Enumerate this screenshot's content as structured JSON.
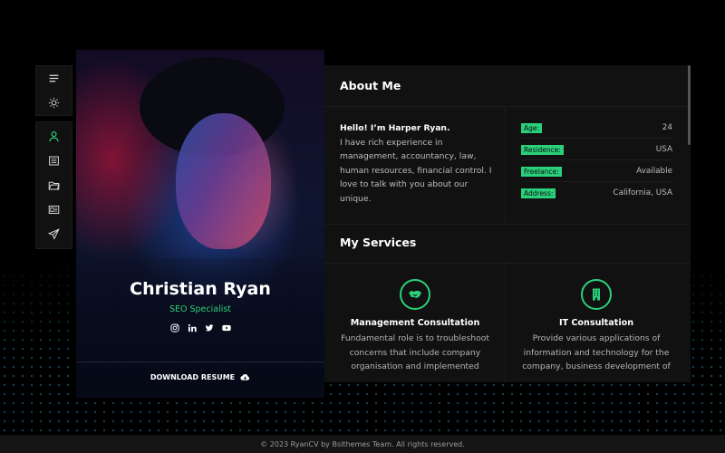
{
  "sidebar": {
    "top": [
      {
        "name": "menu-icon"
      },
      {
        "name": "sun-icon"
      }
    ],
    "nav": [
      {
        "name": "user-icon",
        "active": true
      },
      {
        "name": "resume-icon"
      },
      {
        "name": "folder-icon"
      },
      {
        "name": "blog-icon"
      },
      {
        "name": "send-icon"
      }
    ]
  },
  "profile": {
    "name": "Christian Ryan",
    "role": "SEO Specialist",
    "socials": [
      "instagram-icon",
      "linkedin-icon",
      "twitter-icon",
      "youtube-icon"
    ],
    "download_label": "DOWNLOAD RESUME"
  },
  "about": {
    "title": "About Me",
    "hello": "Hello! I’m Harper Ryan.",
    "body": "I have rich experience in management, accountancy, law, human resources, financial control. I love to talk with you about our unique.",
    "info": [
      {
        "label": "Age:",
        "value": "24"
      },
      {
        "label": "Residence:",
        "value": "USA"
      },
      {
        "label": "Freelance:",
        "value": "Available"
      },
      {
        "label": "Address:",
        "value": "California, USA"
      }
    ]
  },
  "services": {
    "title": "My Services",
    "items": [
      {
        "title": "Management Consultation",
        "desc": "Fundamental role is to troubleshoot concerns that include company organisation and implemented",
        "icon": "handshake-icon"
      },
      {
        "title": "IT Consultation",
        "desc": "Provide various applications of information and technology for the company, business development of",
        "icon": "building-icon"
      }
    ]
  },
  "footer": {
    "text": "© 2023 RyanCV by Bslthemes Team. All rights reserved."
  },
  "colors": {
    "accent": "#2bd07a",
    "panel": "#111111",
    "background": "#000000"
  }
}
